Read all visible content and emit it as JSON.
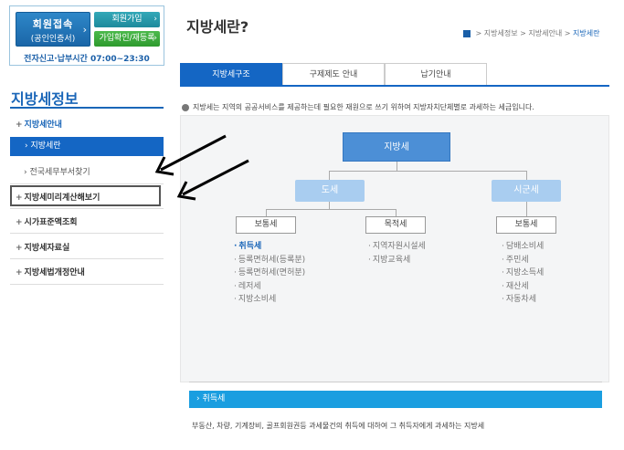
{
  "login": {
    "main_line1": "회원접속",
    "main_line2": "(공인인증서)",
    "main_arrow": "›",
    "join_label": "회원가입",
    "confirm_label": "가입확인/재등록",
    "btn_arrow": "›",
    "hours": "전자신고·납부시간 07:00~23:30"
  },
  "sidebar": {
    "title": "지방세정보",
    "items": [
      {
        "plus": "+",
        "label": "지방세안내"
      },
      {
        "plus": "+",
        "label": "지방세미리계산해보기"
      },
      {
        "plus": "+",
        "label": "시가표준액조회"
      },
      {
        "plus": "+",
        "label": "지방세자료실"
      },
      {
        "plus": "+",
        "label": "지방세법개정안내"
      }
    ],
    "active": "› 지방세란",
    "sub": "› 전국세무부서찾기"
  },
  "header": {
    "title": "지방세란?",
    "breadcrumb": [
      "지방세정보",
      "지방세안내",
      "지방세란"
    ],
    "sep": ">"
  },
  "tabs": [
    "지방세구조",
    "구제제도 안내",
    "납기안내"
  ],
  "description": "지방세는 지역의 공공서비스를 제공하는데 필요한 재원으로 쓰기 위하여 지방자치단체별로 과세하는 세금입니다.",
  "diagram": {
    "root": "지방세",
    "do": "도세",
    "sigun": "시군세",
    "do_general": "보통세",
    "do_purpose": "목적세",
    "sigun_general": "보통세",
    "list_do_general": [
      "취득세",
      "등록면허세(등록분)",
      "등록면허세(면허분)",
      "레저세",
      "지방소비세"
    ],
    "list_do_purpose": [
      "지역자원시설세",
      "지방교육세"
    ],
    "list_sigun_general": [
      "담배소비세",
      "주민세",
      "지방소득세",
      "재산세",
      "자동차세"
    ]
  },
  "acquisition": {
    "title": "› 취득세",
    "desc": "부동산, 차량, 기계장비, 골프회원권등 과세물건의 취득에 대하여 그 취득자에게 과세하는 지방세"
  },
  "colors": {
    "primary": "#1466c4",
    "join": "#1d8a9c",
    "confirm": "#2e9a2e",
    "node_top": "#4c8fd6",
    "node_mid": "#a9cdf0",
    "acq_bar": "#1a9ee0"
  }
}
